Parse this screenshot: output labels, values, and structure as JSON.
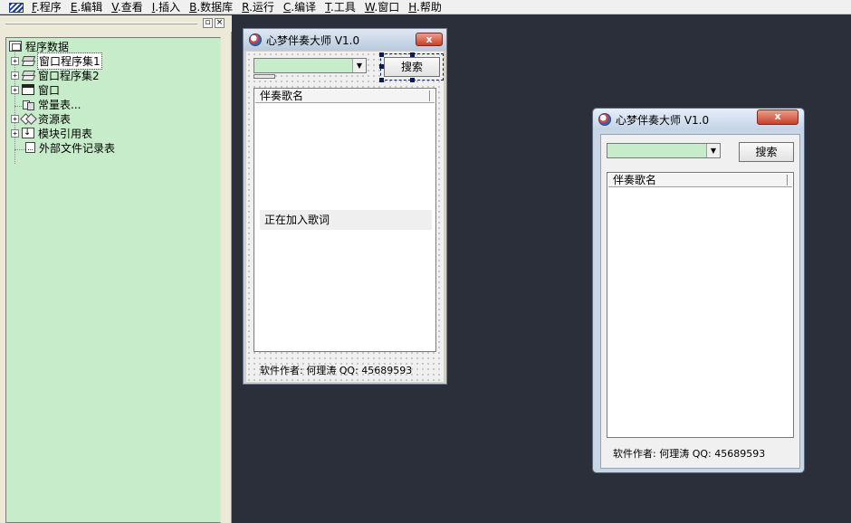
{
  "menubar": {
    "items": [
      {
        "key": "F",
        "label": ".程序"
      },
      {
        "key": "E",
        "label": ".编辑"
      },
      {
        "key": "V",
        "label": ".查看"
      },
      {
        "key": "I",
        "label": ".插入"
      },
      {
        "key": "B",
        "label": ".数据库"
      },
      {
        "key": "R",
        "label": ".运行"
      },
      {
        "key": "C",
        "label": ".编译"
      },
      {
        "key": "T",
        "label": ".工具"
      },
      {
        "key": "W",
        "label": ".窗口"
      },
      {
        "key": "H",
        "label": ".帮助"
      }
    ]
  },
  "panel": {
    "pin_glyph": "▫",
    "close_glyph": "×"
  },
  "tree": {
    "root": "程序数据",
    "items": [
      {
        "label": "窗口程序集1",
        "icon": "stack-icon",
        "expand": "+"
      },
      {
        "label": "窗口程序集2",
        "icon": "stack-icon",
        "expand": "+"
      },
      {
        "label": "窗口",
        "icon": "window-icon",
        "expand": "+"
      },
      {
        "label": "常量表...",
        "icon": "constant-icon",
        "expand": ""
      },
      {
        "label": "资源表",
        "icon": "resource-icon",
        "expand": "+"
      },
      {
        "label": "模块引用表",
        "icon": "module-icon",
        "expand": "+"
      },
      {
        "label": "外部文件记录表",
        "icon": "file-icon",
        "expand": ""
      }
    ]
  },
  "designer": {
    "title": "心梦伴奏大师 V1.0",
    "close": "x",
    "search_button": "搜索",
    "combo_arrow": "▼",
    "list_header": "伴奏歌名",
    "loading_text": "正在加入歌词",
    "status": "软件作者: 何理涛 QQ: 45689593"
  },
  "preview": {
    "title": "心梦伴奏大师 V1.0",
    "close": "x",
    "search_button": "搜索",
    "combo_arrow": "▼",
    "list_header": "伴奏歌名",
    "status": "软件作者: 何理涛 QQ: 45689593"
  },
  "colors": {
    "workspace": "#2b2f3a",
    "tree_bg": "#c7ecc9",
    "combo_bg": "#c7ecc9"
  }
}
